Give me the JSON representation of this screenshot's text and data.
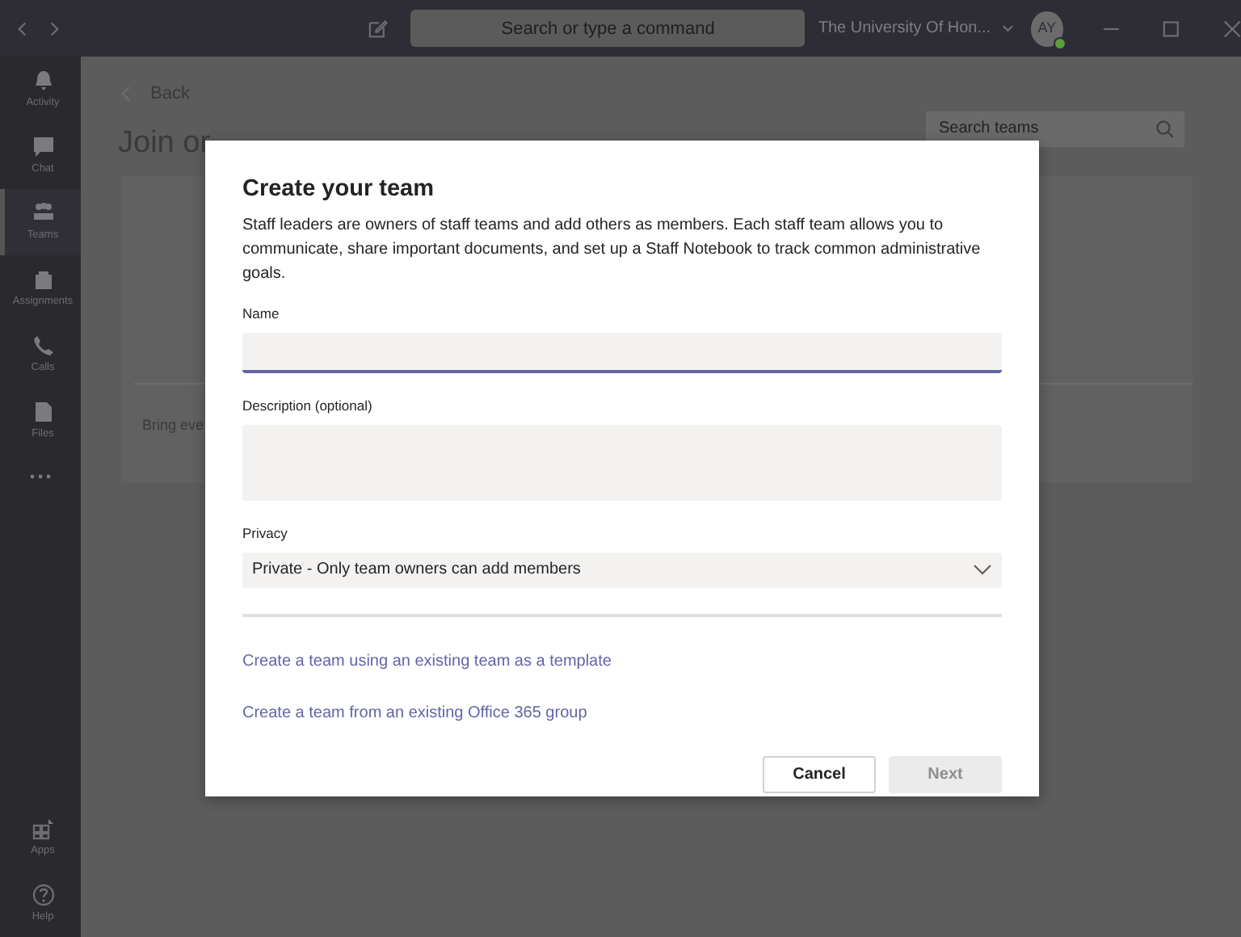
{
  "title_bar": {
    "search": {
      "placeholder": "Search or type a command"
    },
    "org_name": "The University Of Hon...",
    "avatar": {
      "initials": "AY"
    }
  },
  "rail": {
    "items": [
      {
        "label": "Activity",
        "selected": false
      },
      {
        "label": "Chat",
        "selected": false
      },
      {
        "label": "Teams",
        "selected": true
      },
      {
        "label": "Assignments",
        "selected": false
      },
      {
        "label": "Calls",
        "selected": false
      },
      {
        "label": "Files",
        "selected": false
      }
    ],
    "bottom_items": [
      {
        "label": "Apps",
        "selected": false
      },
      {
        "label": "Help",
        "selected": false
      }
    ]
  },
  "page": {
    "back_label": "Back",
    "heading": "Join or",
    "search_teams": {
      "placeholder": "Search teams"
    },
    "card_text": "Bring eve"
  },
  "dialog": {
    "title": "Create your team",
    "description": "Staff leaders are owners of staff teams and add others as members. Each staff team allows you to communicate, share important documents, and set up a Staff Notebook to track common administrative goals.",
    "name_field": {
      "label": "Name",
      "focused": true
    },
    "description_field": {
      "label": "Description (optional)",
      "focused": false
    },
    "privacy": {
      "label": "Privacy",
      "value": "Private - Only team owners can add members"
    },
    "links": [
      "Create a team using an existing team as a template",
      "Create a team from an existing Office 365 group"
    ],
    "buttons": [
      {
        "label": "Cancel",
        "kind": "secondary",
        "disabled": false
      },
      {
        "label": "Next",
        "kind": "primary",
        "disabled": true
      }
    ]
  }
}
